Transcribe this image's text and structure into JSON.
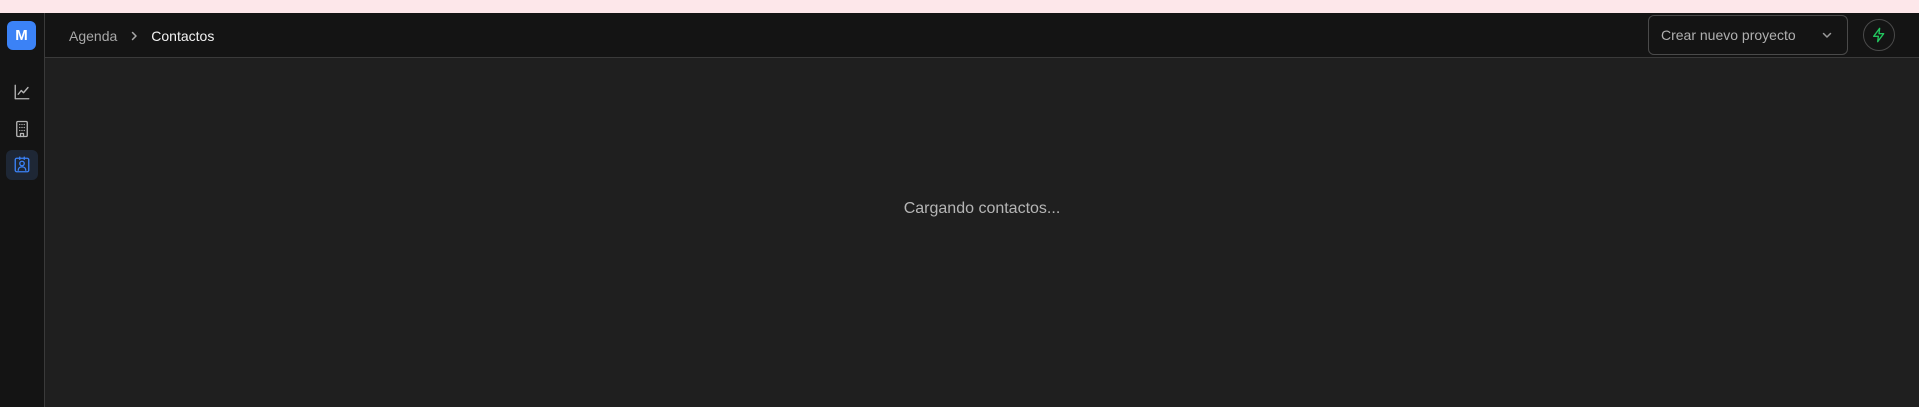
{
  "app": {
    "logo_letter": "M",
    "accent": "#3b82f6"
  },
  "sidebar": {
    "items": [
      {
        "icon": "line-chart-icon",
        "active": false
      },
      {
        "icon": "building-icon",
        "active": false
      },
      {
        "icon": "contact-card-icon",
        "active": true
      }
    ]
  },
  "breadcrumb": {
    "parent": "Agenda",
    "current": "Contactos"
  },
  "header": {
    "project_select_value": "Crear nuevo proyecto",
    "action_icon": "lightning-bolt-icon",
    "action_color": "#22c55e"
  },
  "main": {
    "loading_text": "Cargando contactos..."
  }
}
